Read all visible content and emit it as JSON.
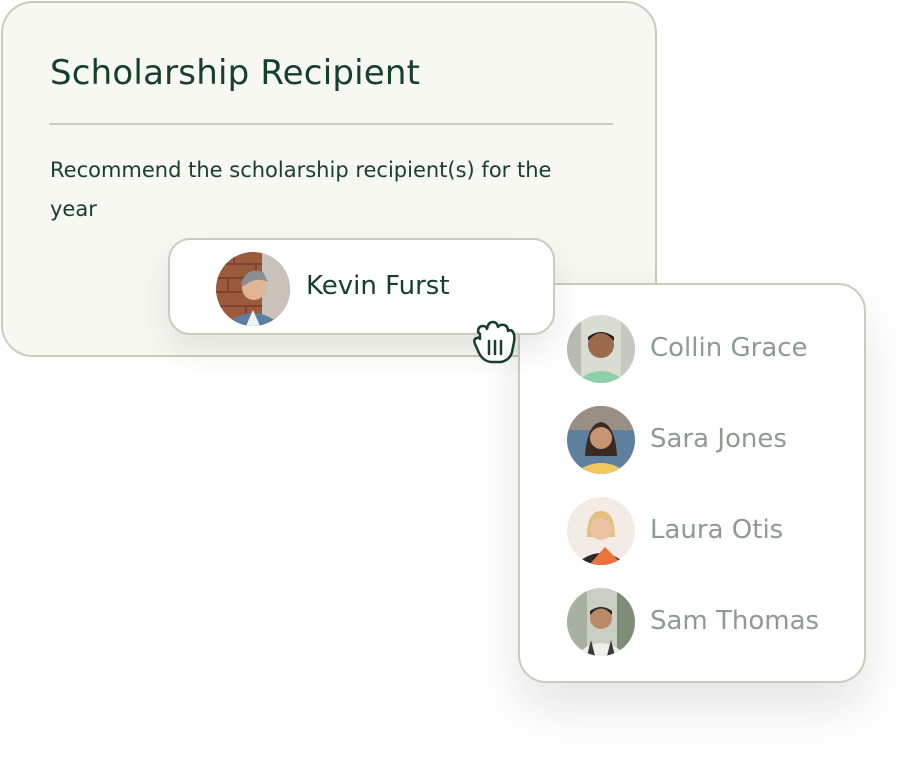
{
  "card": {
    "title": "Scholarship Recipient",
    "description": "Recommend the scholarship recipient(s) for the year"
  },
  "selected": {
    "name": "Kevin Furst"
  },
  "dropdown": {
    "options": [
      {
        "name": "Collin Grace"
      },
      {
        "name": "Sara Jones"
      },
      {
        "name": "Laura Otis"
      },
      {
        "name": "Sam Thomas"
      }
    ]
  },
  "cursor": {
    "icon": "grab-hand-icon"
  },
  "colors": {
    "title_text": "#17402c",
    "option_text": "#8b9c90",
    "border": "#c9ccba",
    "card_background": "#f8f8f3"
  }
}
